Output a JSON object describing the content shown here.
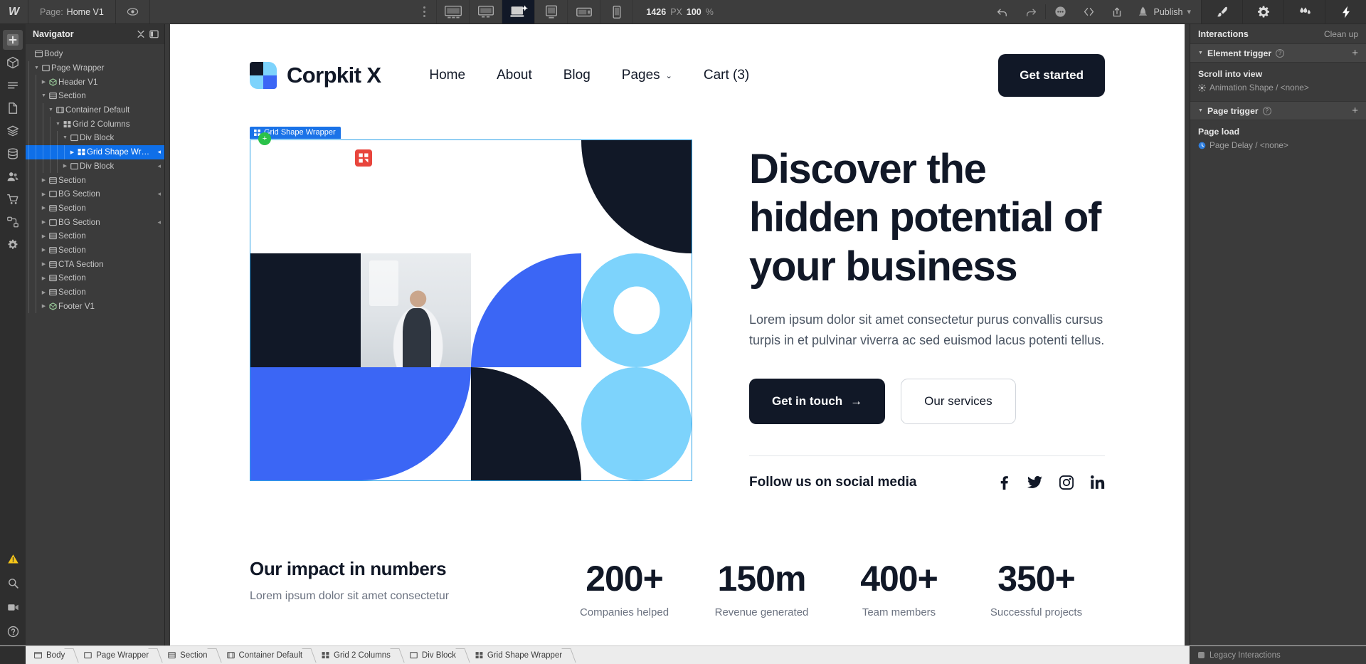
{
  "topbar": {
    "brand_icon": "webflow-logo-icon",
    "page_label": "Page:",
    "page_name": "Home V1",
    "preview_icon": "eye-icon",
    "devices": [
      {
        "name": "device-desktop-xl",
        "active": false
      },
      {
        "name": "device-desktop-lg",
        "active": false
      },
      {
        "name": "device-desktop-main",
        "active": true
      },
      {
        "name": "device-tablet",
        "active": false
      },
      {
        "name": "device-mobile-landscape",
        "active": false
      },
      {
        "name": "device-mobile-portrait",
        "active": false
      }
    ],
    "viewport_width": "1426",
    "viewport_unit": "PX",
    "zoom_value": "100",
    "zoom_unit": "%",
    "undo_icon": "undo-icon",
    "redo_icon": "redo-icon",
    "more_icon": "ellipsis-icon",
    "code_icon": "code-brackets-icon",
    "share_icon": "share-export-icon",
    "publish_label": "Publish",
    "publish_icon": "rocket-icon",
    "right_panes": [
      "brush-icon",
      "gear-icon",
      "interactions-icon",
      "lightning-icon"
    ]
  },
  "rail": {
    "items": [
      "add-element-icon",
      "components-icon",
      "style-manager-icon",
      "pages-icon",
      "assets-icon",
      "cms-icon",
      "users-icon",
      "ecommerce-icon",
      "logic-icon",
      "app-settings-icon"
    ],
    "bottom_items": [
      "audit-warning-icon",
      "search-icon",
      "video-tutorial-icon",
      "help-icon"
    ]
  },
  "navigator": {
    "title": "Navigator",
    "collapse_icon": "collapse-all-icon",
    "panel_icon": "panel-layout-icon",
    "tree": [
      {
        "label": "Body",
        "depth": 0,
        "icon": "body-icon",
        "caret": "",
        "selected": false,
        "trigger": false
      },
      {
        "label": "Page Wrapper",
        "depth": 1,
        "icon": "div-icon",
        "caret": "down",
        "selected": false,
        "trigger": false
      },
      {
        "label": "Header V1",
        "depth": 2,
        "icon": "component-icon",
        "caret": "right",
        "selected": false,
        "trigger": false
      },
      {
        "label": "Section",
        "depth": 2,
        "icon": "section-icon",
        "caret": "down",
        "selected": false,
        "trigger": false
      },
      {
        "label": "Container Default",
        "depth": 3,
        "icon": "container-icon",
        "caret": "down",
        "selected": false,
        "trigger": false
      },
      {
        "label": "Grid 2 Columns",
        "depth": 4,
        "icon": "grid-icon",
        "caret": "down",
        "selected": false,
        "trigger": false
      },
      {
        "label": "Div Block",
        "depth": 5,
        "icon": "div-icon",
        "caret": "down",
        "selected": false,
        "trigger": false
      },
      {
        "label": "Grid Shape Wr…",
        "depth": 6,
        "icon": "grid-icon",
        "caret": "right",
        "selected": true,
        "trigger": true
      },
      {
        "label": "Div Block",
        "depth": 5,
        "icon": "div-icon",
        "caret": "right",
        "selected": false,
        "trigger": true
      },
      {
        "label": "Section",
        "depth": 2,
        "icon": "section-icon",
        "caret": "right",
        "selected": false,
        "trigger": false
      },
      {
        "label": "BG Section",
        "depth": 2,
        "icon": "div-icon",
        "caret": "right",
        "selected": false,
        "trigger": true
      },
      {
        "label": "Section",
        "depth": 2,
        "icon": "section-icon",
        "caret": "right",
        "selected": false,
        "trigger": false
      },
      {
        "label": "BG Section",
        "depth": 2,
        "icon": "div-icon",
        "caret": "right",
        "selected": false,
        "trigger": true
      },
      {
        "label": "Section",
        "depth": 2,
        "icon": "section-icon",
        "caret": "right",
        "selected": false,
        "trigger": false
      },
      {
        "label": "Section",
        "depth": 2,
        "icon": "section-icon",
        "caret": "right",
        "selected": false,
        "trigger": false
      },
      {
        "label": "CTA Section",
        "depth": 2,
        "icon": "section-icon",
        "caret": "right",
        "selected": false,
        "trigger": false
      },
      {
        "label": "Section",
        "depth": 2,
        "icon": "section-icon",
        "caret": "right",
        "selected": false,
        "trigger": false
      },
      {
        "label": "Section",
        "depth": 2,
        "icon": "section-icon",
        "caret": "right",
        "selected": false,
        "trigger": false
      },
      {
        "label": "Footer V1",
        "depth": 2,
        "icon": "component-icon",
        "caret": "right",
        "selected": false,
        "trigger": false
      }
    ]
  },
  "canvas": {
    "selected_element_label": "Grid Shape Wrapper",
    "selection_color": "#1a73e8",
    "site": {
      "brand": "Corpkit X",
      "nav_links": [
        {
          "label": "Home",
          "has_dropdown": false
        },
        {
          "label": "About",
          "has_dropdown": false
        },
        {
          "label": "Blog",
          "has_dropdown": false
        },
        {
          "label": "Pages",
          "has_dropdown": true
        },
        {
          "label": "Cart (3)",
          "has_dropdown": false
        }
      ],
      "nav_cta": "Get started",
      "hero_heading": "Discover the hidden potential of your business",
      "hero_paragraph": "Lorem ipsum dolor sit amet consectetur purus convallis cursus turpis in et pulvinar viverra ac sed euismod lacus potenti tellus.",
      "primary_button": "Get in touch",
      "primary_button_arrow": "→",
      "secondary_button": "Our services",
      "social_label": "Follow us on social media",
      "social_icons": [
        "facebook-icon",
        "twitter-icon",
        "instagram-icon",
        "linkedin-icon"
      ],
      "impact_heading": "Our impact in numbers",
      "impact_sub": "Lorem ipsum dolor sit amet consectetur",
      "stats": [
        {
          "number": "200+",
          "caption": "Companies helped"
        },
        {
          "number": "150m",
          "caption": "Revenue generated"
        },
        {
          "number": "400+",
          "caption": "Team members"
        },
        {
          "number": "350+",
          "caption": "Successful projects"
        }
      ],
      "colors": {
        "dark": "#111827",
        "blue": "#3b66f5",
        "sky": "#7dd3fc",
        "white": "#ffffff"
      }
    }
  },
  "interactions": {
    "title": "Interactions",
    "clean_up": "Clean up",
    "element_trigger": {
      "title": "Element trigger",
      "help_icon": "question-icon",
      "add_icon": "plus-icon",
      "item_name": "Scroll into view",
      "item_detail": "Animation Shape / <none>",
      "item_icon": "animation-icon"
    },
    "page_trigger": {
      "title": "Page trigger",
      "help_icon": "question-icon",
      "add_icon": "plus-icon",
      "item_name": "Page load",
      "item_detail": "Page Delay / <none>",
      "item_icon": "page-delay-icon"
    }
  },
  "bottombar": {
    "breadcrumbs": [
      {
        "label": "Body",
        "icon": "body-icon"
      },
      {
        "label": "Page Wrapper",
        "icon": "div-icon"
      },
      {
        "label": "Section",
        "icon": "section-icon"
      },
      {
        "label": "Container Default",
        "icon": "container-icon"
      },
      {
        "label": "Grid 2 Columns",
        "icon": "grid-icon"
      },
      {
        "label": "Div Block",
        "icon": "div-icon"
      },
      {
        "label": "Grid Shape Wrapper",
        "icon": "grid-icon"
      }
    ],
    "legacy_label": "Legacy Interactions",
    "legacy_icon": "legacy-toggle-icon"
  }
}
